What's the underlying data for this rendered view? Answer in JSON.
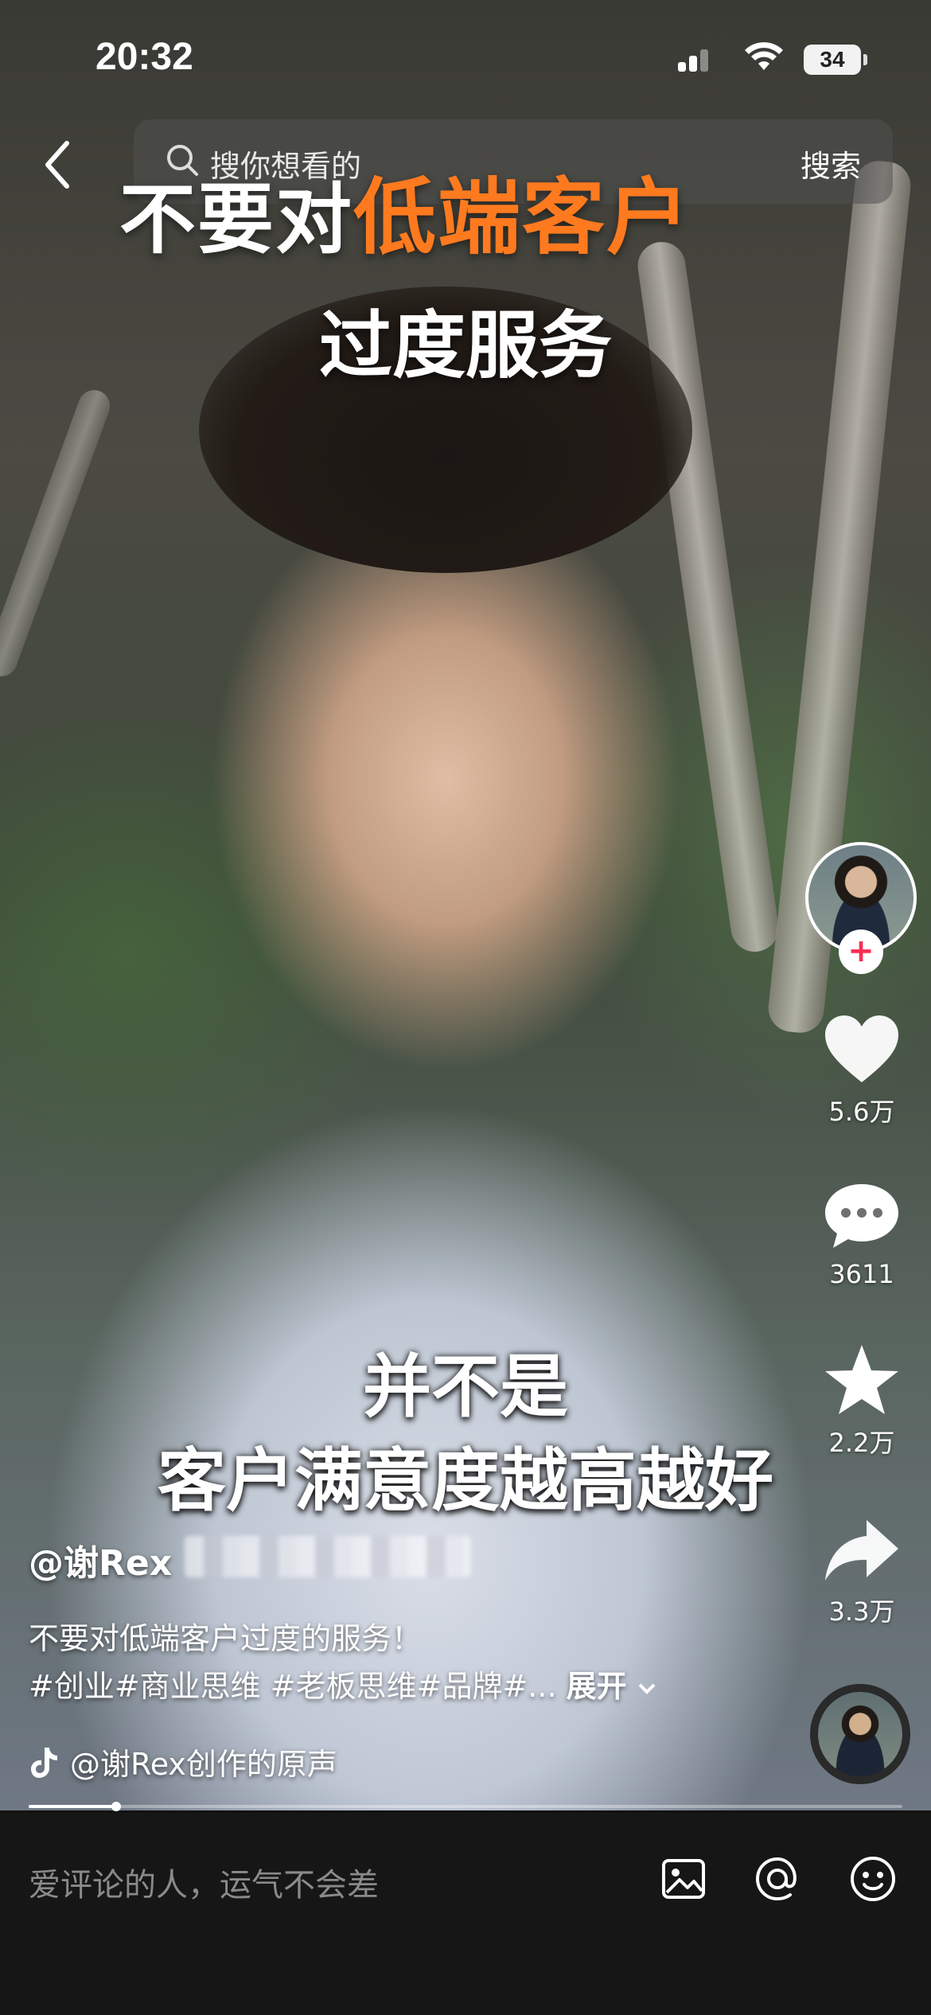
{
  "status_bar": {
    "time": "20:32",
    "battery": "34"
  },
  "search": {
    "placeholder": "搜你想看的",
    "button": "搜索"
  },
  "video_title": {
    "white": "不要对",
    "orange": "低端客户",
    "line2": "过度服务"
  },
  "subtitle": {
    "line1": "并不是",
    "line2": "客户满意度越高越好"
  },
  "actions": {
    "likes": "5.6万",
    "comments": "3611",
    "favorites": "2.2万",
    "shares": "3.3万",
    "follow_symbol": "+"
  },
  "post": {
    "author": "@谢Rex",
    "description": "不要对低端客户过度的服务！",
    "tags": "#创业#商业思维 #老板思维#品牌#...",
    "expand": "展开",
    "music": "@谢Rex创作的原声"
  },
  "progress": {
    "fraction": 0.1
  },
  "comment_bar": {
    "placeholder": "爱评论的人，运气不会差"
  }
}
